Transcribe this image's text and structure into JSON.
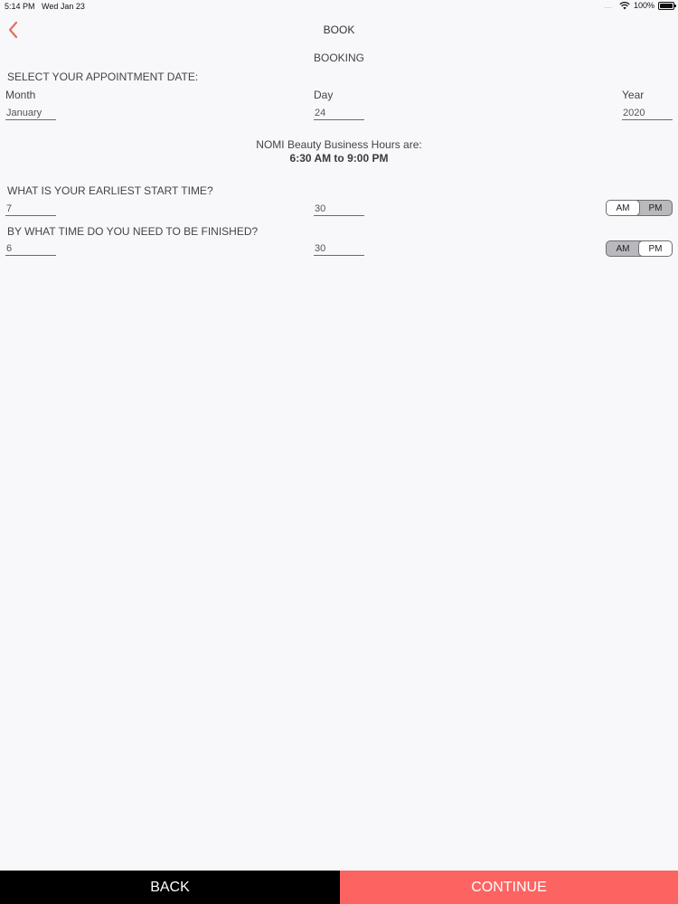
{
  "status_bar": {
    "time": "5:14 PM",
    "date": "Wed Jan 23",
    "signal_dots": "....",
    "battery": "100%"
  },
  "nav": {
    "title": "BOOK",
    "back_icon": "chevron-left-icon",
    "accent_color": "#e0705e"
  },
  "page": {
    "subtitle": "BOOKING"
  },
  "date_section": {
    "heading": "SELECT YOUR APPOINTMENT DATE:",
    "month_label": "Month",
    "month_value": "January",
    "day_label": "Day",
    "day_value": "24",
    "year_label": "Year",
    "year_value": "2020"
  },
  "hours": {
    "label": "NOMI Beauty Business Hours are:",
    "value": "6:30 AM to 9:00 PM"
  },
  "start_time": {
    "heading": "WHAT IS YOUR EARLIEST START TIME?",
    "hour_value": "7",
    "minute_value": "30",
    "am_label": "AM",
    "pm_label": "PM",
    "selected": "AM"
  },
  "end_time": {
    "heading": "BY WHAT TIME DO YOU NEED TO BE FINISHED?",
    "hour_value": "6",
    "minute_value": "30",
    "am_label": "AM",
    "pm_label": "PM",
    "selected": "PM"
  },
  "footer": {
    "back_label": "BACK",
    "continue_label": "CONTINUE",
    "back_color": "#000000",
    "continue_color": "#fc6462"
  }
}
